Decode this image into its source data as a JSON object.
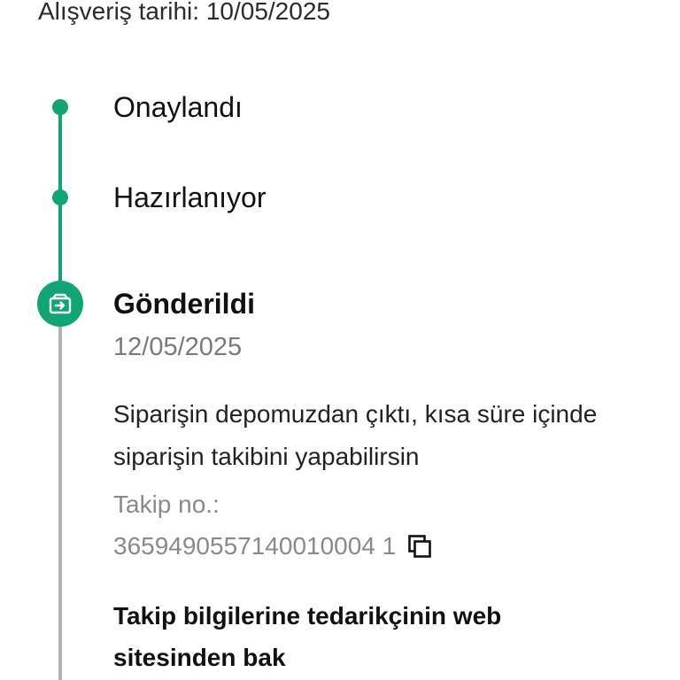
{
  "order": {
    "purchase_date_text": "Alışveriş tarihi: 10/05/2025"
  },
  "timeline": {
    "steps": [
      {
        "label": "Onaylandı"
      },
      {
        "label": "Hazırlanıyor"
      },
      {
        "label": "Gönderildi",
        "date": "12/05/2025",
        "current": true
      }
    ],
    "description": "Siparişin depomuzdan çıktı, kısa süre içinde siparişin takibini yapabilirsin",
    "tracking_label": "Takip no.:",
    "tracking_number": "3659490557140010004 1",
    "supplier_link": "Takip bilgilerine tedarikçinin web sitesinden bak"
  },
  "colors": {
    "accent": "#10a575",
    "inactive_line": "#b3b3b3",
    "muted_text": "#8a8a8a"
  },
  "icons": {
    "current_step": "package-out-icon",
    "copy": "copy-icon"
  }
}
